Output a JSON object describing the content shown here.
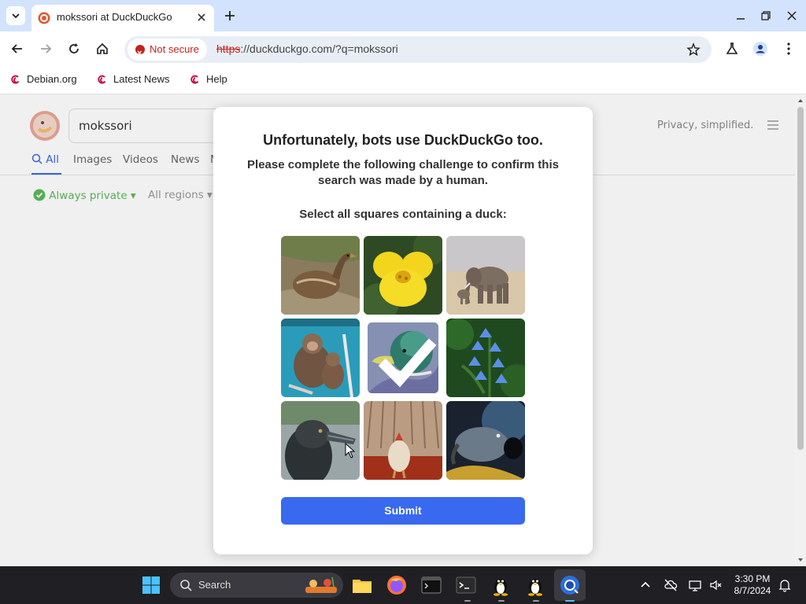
{
  "browser": {
    "tab_title": "mokssori at DuckDuckGo",
    "security_label": "Not secure",
    "url_scheme": "https",
    "url_rest": "://duckduckgo.com/?q=mokssori",
    "bookmarks": [
      "Debian.org",
      "Latest News",
      "Help"
    ]
  },
  "ddg": {
    "query": "mokssori",
    "tagline": "Privacy, simplified.",
    "tabs": [
      "All",
      "Images",
      "Videos",
      "News",
      "M"
    ],
    "filters": {
      "privacy": "Always private ▾",
      "region": "All regions ▾"
    }
  },
  "challenge": {
    "title": "Unfortunately, bots use DuckDuckGo too.",
    "subtitle": "Please complete the following challenge to confirm this search was made by a human.",
    "prompt": "Select all squares containing a duck:",
    "tiles": [
      {
        "subject": "duck-on-rocks",
        "selected": false
      },
      {
        "subject": "yellow-flower",
        "selected": false
      },
      {
        "subject": "elephants",
        "selected": false
      },
      {
        "subject": "monkeys",
        "selected": false
      },
      {
        "subject": "mallard-head",
        "selected": true
      },
      {
        "subject": "bluebells",
        "selected": false
      },
      {
        "subject": "duck-head-profile",
        "selected": false
      },
      {
        "subject": "chickens",
        "selected": false
      },
      {
        "subject": "bird-dark",
        "selected": false
      }
    ],
    "submit_label": "Submit"
  },
  "taskbar": {
    "search_label": "Search",
    "time": "3:30 PM",
    "date": "8/7/2024"
  },
  "colors": {
    "accent": "#3969ef",
    "tabbar": "#d3e3fd",
    "not_secure": "#c5221f",
    "taskbar": "#1f1f24"
  }
}
